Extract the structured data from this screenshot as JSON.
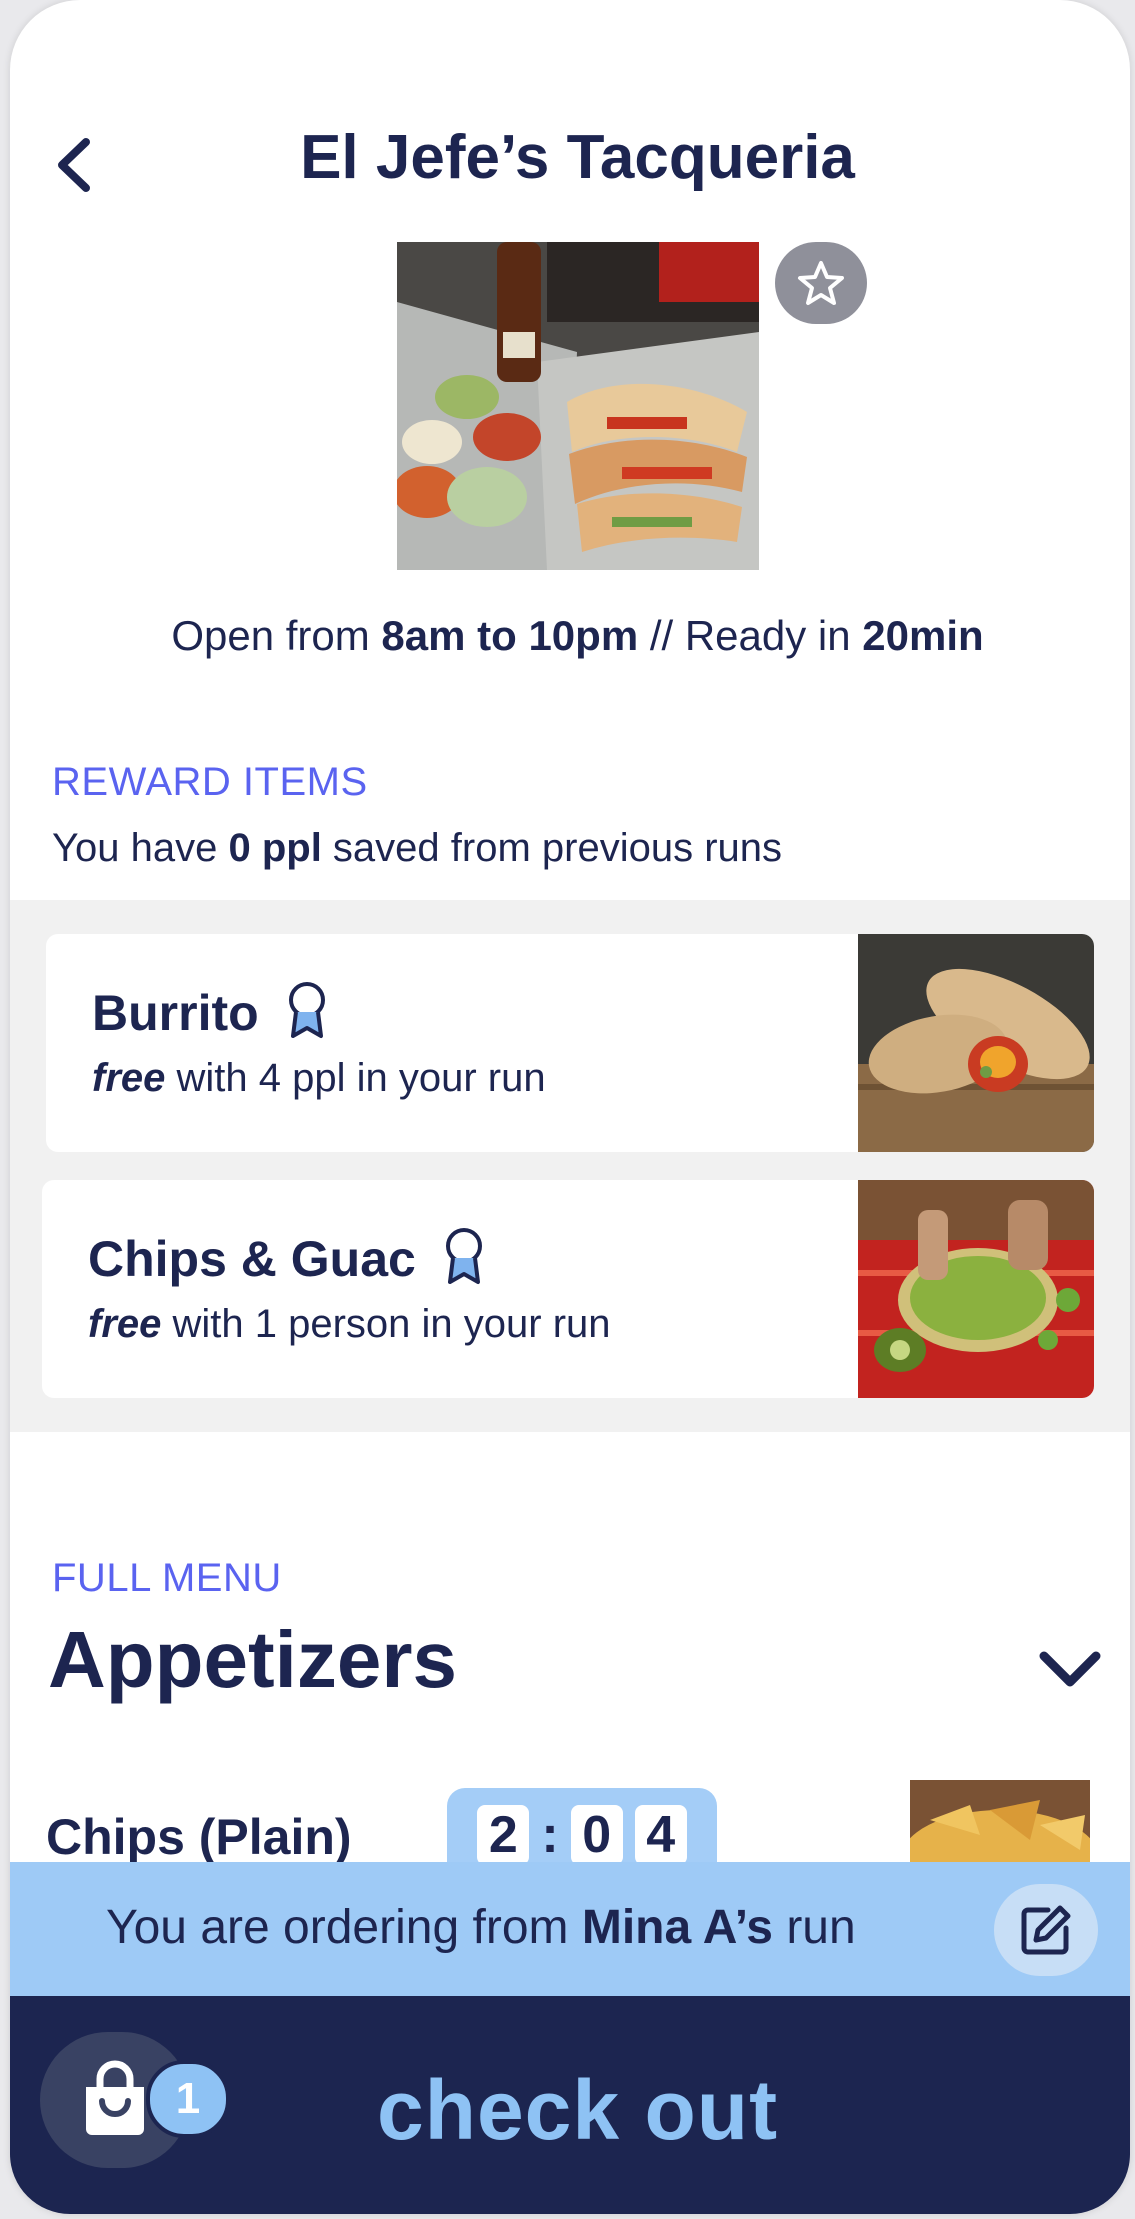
{
  "header": {
    "title": "El Jefe’s Tacqueria",
    "back_icon": "chevron-left-icon",
    "favorite_icon": "star-icon"
  },
  "info": {
    "hours_prefix": "Open from ",
    "hours": "8am to 10pm",
    "ready_prefix": " // Ready in ",
    "ready_time": "20min"
  },
  "rewards": {
    "label": "REWARD ITEMS",
    "sub_prefix": "You have ",
    "sub_count": "0 ppl",
    "sub_suffix": " saved from previous runs",
    "items": [
      {
        "name": "Burrito",
        "free": "free",
        "desc": " with 4 ppl in your run",
        "icon": "award-ribbon-icon"
      },
      {
        "name": "Chips & Guac",
        "free": "free",
        "desc": " with 1 person in your run",
        "icon": "award-ribbon-icon"
      }
    ]
  },
  "menu": {
    "label": "FULL MENU",
    "category": "Appetizers",
    "toggle_icon": "chevron-down-icon",
    "items": [
      {
        "name": "Chips (Plain)"
      }
    ]
  },
  "timer": {
    "d1": "2",
    "d2": "0",
    "d3": "4"
  },
  "run": {
    "prefix": "You are ordering from ",
    "name": "Mina A’s",
    "suffix": " run",
    "edit_icon": "edit-icon"
  },
  "checkout": {
    "label": "check out",
    "cart_count": "1",
    "cart_icon": "bag-icon"
  },
  "colors": {
    "navy": "#1d2550",
    "accent": "#5a63f0",
    "light_blue": "#9ecaf6",
    "checkout_bg": "#1c2550"
  }
}
